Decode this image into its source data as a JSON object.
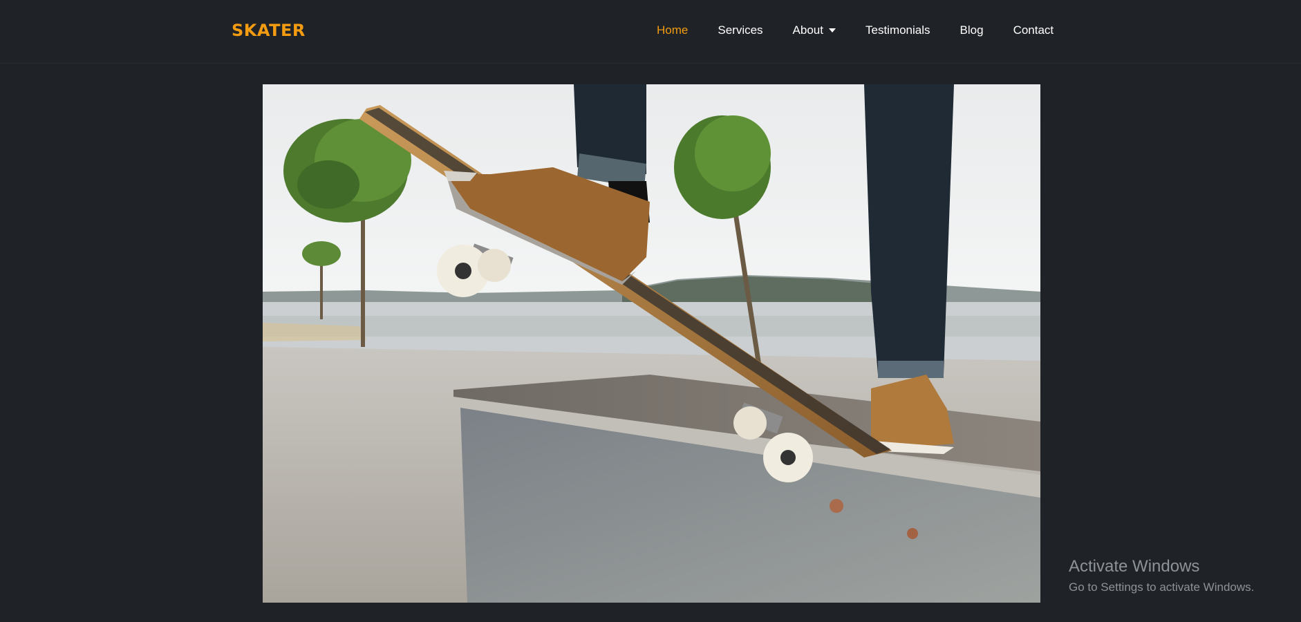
{
  "brand": {
    "name": "SKATER",
    "color": "#f39c12"
  },
  "nav": {
    "items": [
      {
        "label": "Home",
        "active": true
      },
      {
        "label": "Services",
        "active": false
      },
      {
        "label": "About",
        "active": false,
        "dropdown": true
      },
      {
        "label": "Testimonials",
        "active": false
      },
      {
        "label": "Blog",
        "active": false
      },
      {
        "label": "Contact",
        "active": false
      }
    ]
  },
  "hero": {
    "image_subject": "skateboarder stepping onto a wooden ledge by a lake with trees"
  },
  "watermark": {
    "title": "Activate Windows",
    "subtitle": "Go to Settings to activate Windows."
  },
  "colors": {
    "background": "#1f2226",
    "accent": "#f39c12",
    "text": "#ffffff"
  }
}
